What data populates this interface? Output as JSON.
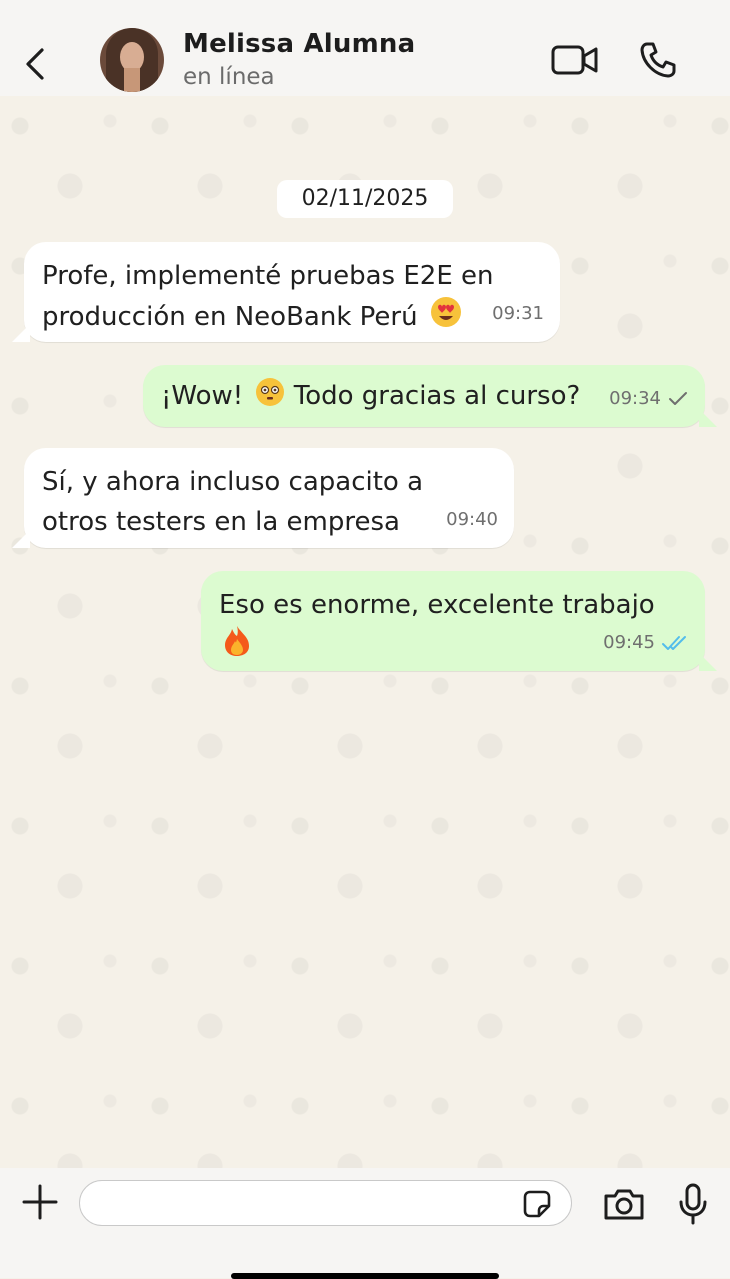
{
  "header": {
    "contact_name": "Melissa Alumna",
    "status": "en línea"
  },
  "chat": {
    "date": "02/11/2025",
    "messages": [
      {
        "direction": "incoming",
        "text": "Profe, implementé pruebas E2E en producción en NeoBank Perú",
        "emoji": "heart-eyes-emoji",
        "time": "09:31"
      },
      {
        "direction": "outgoing",
        "text_before": "¡Wow!",
        "text_after": "Todo gracias al curso?",
        "emoji": "flushed-emoji",
        "time": "09:34",
        "ticks": "single"
      },
      {
        "direction": "incoming",
        "text": "Sí, y ahora incluso capacito a otros testers en la empresa",
        "time": "09:40"
      },
      {
        "direction": "outgoing",
        "text": "Eso es enorme, excelente trabajo",
        "emoji": "fire-emoji",
        "time": "09:45",
        "ticks": "double-read"
      }
    ]
  },
  "composer": {
    "message_input_value": ""
  },
  "colors": {
    "incoming_bubble": "#ffffff",
    "outgoing_bubble": "#dcfbd0",
    "read_ticks": "#53bdeb"
  }
}
